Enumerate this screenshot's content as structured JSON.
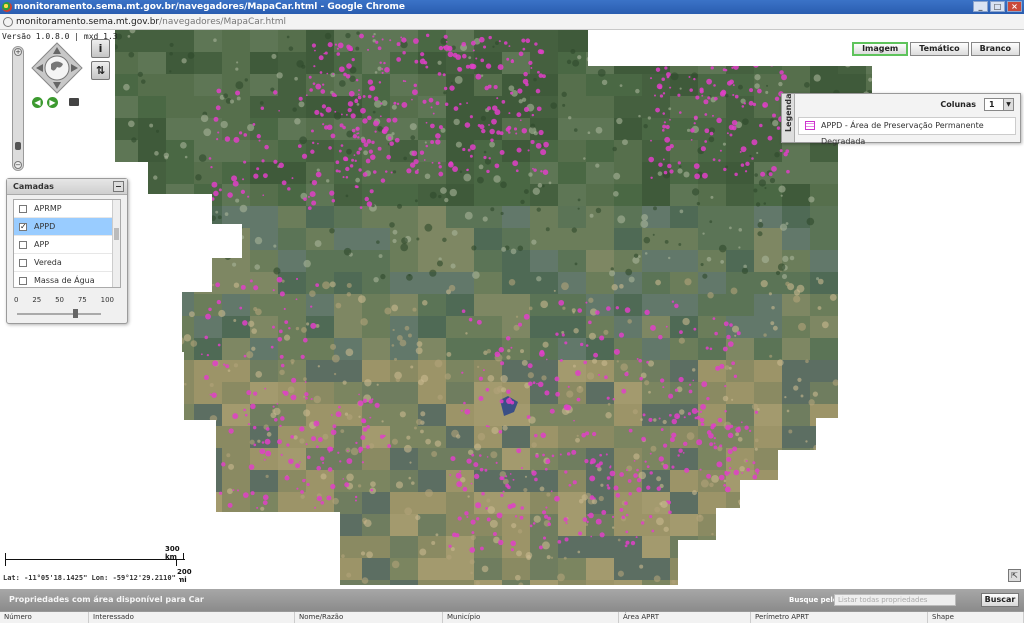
{
  "window": {
    "title": "monitoramento.sema.mt.gov.br/navegadores/MapaCar.html - Google Chrome",
    "url_host": "monitoramento.sema.mt.gov.br",
    "url_path": "/navegadores/MapaCar.html",
    "buttons": [
      "_",
      "□",
      "×"
    ]
  },
  "map": {
    "version": "Versão 1.0.8.0 | mxd 1.3",
    "zoom_in": "+",
    "zoom_out": "−",
    "info_button": "i",
    "measure_button": "⇅",
    "basemap_buttons": [
      {
        "label": "Imagem",
        "active": true
      },
      {
        "label": "Temático",
        "active": false
      },
      {
        "label": "Branco",
        "active": false
      }
    ],
    "highlight_color": "#e040c8"
  },
  "layers": {
    "title": "Camadas",
    "items": [
      {
        "label": "APRMP",
        "checked": false
      },
      {
        "label": "APPD",
        "checked": true
      },
      {
        "label": "APP",
        "checked": false
      },
      {
        "label": "Vereda",
        "checked": false
      },
      {
        "label": "Massa de Água",
        "checked": false
      }
    ],
    "opacity_ticks": [
      "0",
      "25",
      "50",
      "75",
      "100"
    ],
    "opacity_value_percent": 75
  },
  "legend": {
    "tab_label": "Legenda",
    "columns_label": "Colunas",
    "columns_value": "1",
    "entry": "APPD - Área de Preservação Permanente Degradada"
  },
  "scale": {
    "km_label": "300 km",
    "mi_label": "200 mi"
  },
  "status": {
    "coords": "Lat: -11°05'18.1425\"   Lon: -59°12'29.2110\""
  },
  "grid": {
    "title": "Propriedades com área disponível para Car",
    "search_label": "Busque pelo:",
    "search_placeholder": "Listar todas propriedades",
    "search_button": "Buscar",
    "columns": [
      "Número",
      "Interessado",
      "Nome/Razão",
      "Município",
      "Área APRT",
      "Perímetro APRT",
      "Shape"
    ]
  }
}
